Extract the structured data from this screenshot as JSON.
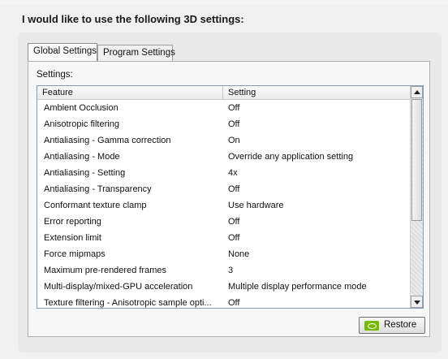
{
  "heading": "I would like to use the following 3D settings:",
  "tabs": [
    {
      "label": "Global Settings",
      "active": true
    },
    {
      "label": "Program Settings",
      "active": false
    }
  ],
  "settings_label": "Settings:",
  "table": {
    "columns": [
      "Feature",
      "Setting"
    ],
    "rows": [
      {
        "feature": "Ambient Occlusion",
        "setting": "Off"
      },
      {
        "feature": "Anisotropic filtering",
        "setting": "Off"
      },
      {
        "feature": "Antialiasing - Gamma correction",
        "setting": "On"
      },
      {
        "feature": "Antialiasing - Mode",
        "setting": "Override any application setting"
      },
      {
        "feature": "Antialiasing - Setting",
        "setting": "4x"
      },
      {
        "feature": "Antialiasing - Transparency",
        "setting": "Off"
      },
      {
        "feature": "Conformant texture clamp",
        "setting": "Use hardware"
      },
      {
        "feature": "Error reporting",
        "setting": "Off"
      },
      {
        "feature": "Extension limit",
        "setting": "Off"
      },
      {
        "feature": "Force mipmaps",
        "setting": "None"
      },
      {
        "feature": "Maximum pre-rendered frames",
        "setting": "3"
      },
      {
        "feature": "Multi-display/mixed-GPU acceleration",
        "setting": "Multiple display performance mode"
      },
      {
        "feature": "Texture filtering - Anisotropic sample opti...",
        "setting": "Off"
      }
    ]
  },
  "restore_button": {
    "label": "Restore",
    "icon": "nvidia-logo-icon",
    "icon_color": "#76b900"
  }
}
